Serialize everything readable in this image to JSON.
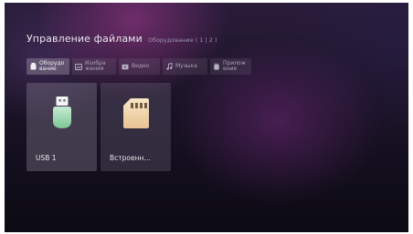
{
  "header": {
    "title": "Управление файлами",
    "subtitle": "Оборудование ( 1 | 2 )"
  },
  "tabs": [
    {
      "label": "Оборудо\nвание",
      "icon": "storage-icon",
      "active": true
    },
    {
      "label": "Изобра\nжения",
      "icon": "image-icon",
      "active": false
    },
    {
      "label": "Видео",
      "icon": "video-icon",
      "active": false
    },
    {
      "label": "Музыка",
      "icon": "music-icon",
      "active": false
    },
    {
      "label": "Прилож\nение",
      "icon": "app-icon",
      "active": false
    }
  ],
  "devices": [
    {
      "label": "USB 1",
      "icon": "usb-drive-icon",
      "color": "#8fd3a6"
    },
    {
      "label": "Встроенн…",
      "icon": "sd-card-icon",
      "color": "#f2d7b0"
    }
  ],
  "colors": {
    "usb_icon_top": "#bfe9cf",
    "usb_icon_bottom": "#7cc596",
    "sd_icon_top": "#f7e2c0",
    "sd_icon_bottom": "#e9c79a"
  }
}
